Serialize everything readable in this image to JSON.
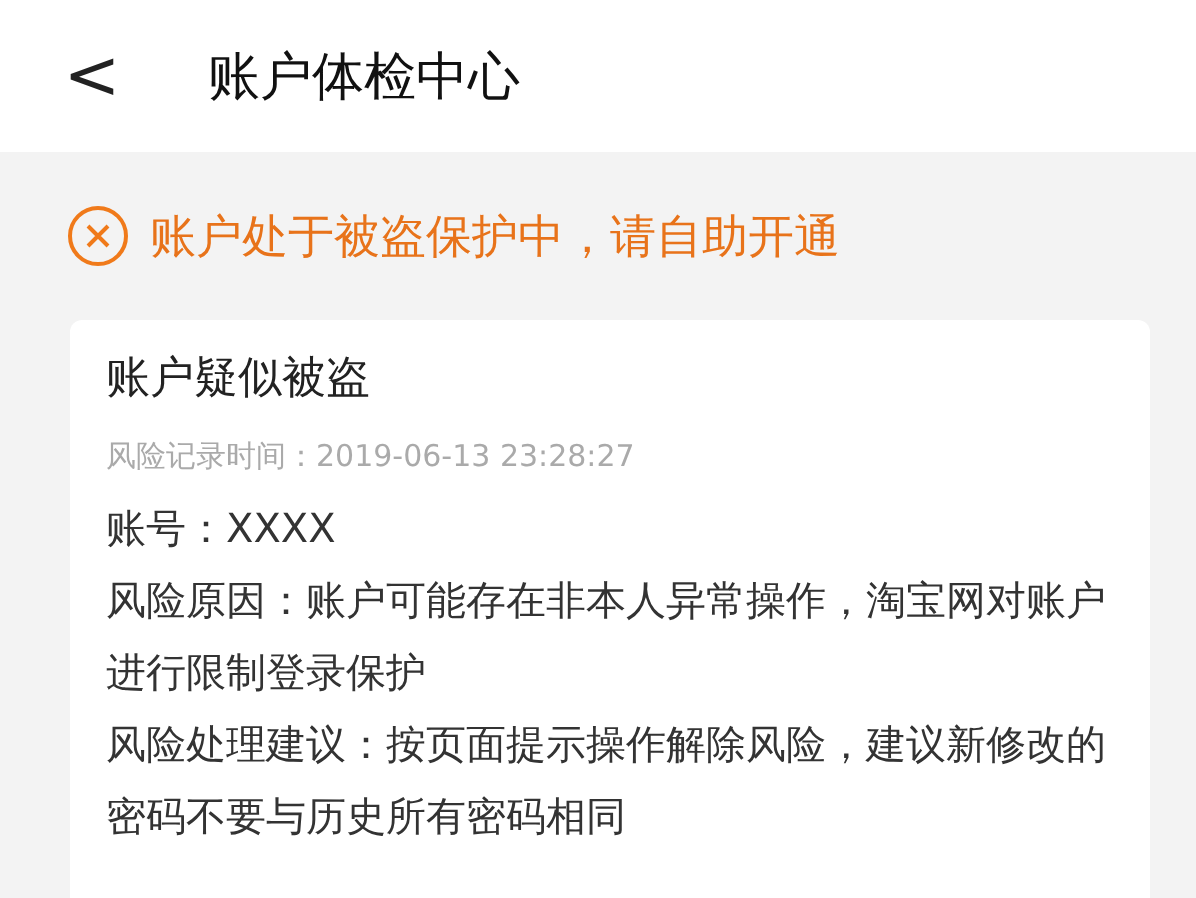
{
  "header": {
    "back": "<",
    "title": "账户体检中心"
  },
  "alert": {
    "text": "账户处于被盗保护中，请自助开通"
  },
  "card": {
    "title": "账户疑似被盗",
    "time": "风险记录时间：2019-06-13 23:28:27",
    "lines": [
      "账号：XXXX",
      "风险原因：账户可能存在非本人异常操作，淘宝网对账户进行限制登录保护",
      "风险处理建议：按页面提示操作解除风险，建议新修改的密码不要与历史所有密码相同"
    ]
  }
}
